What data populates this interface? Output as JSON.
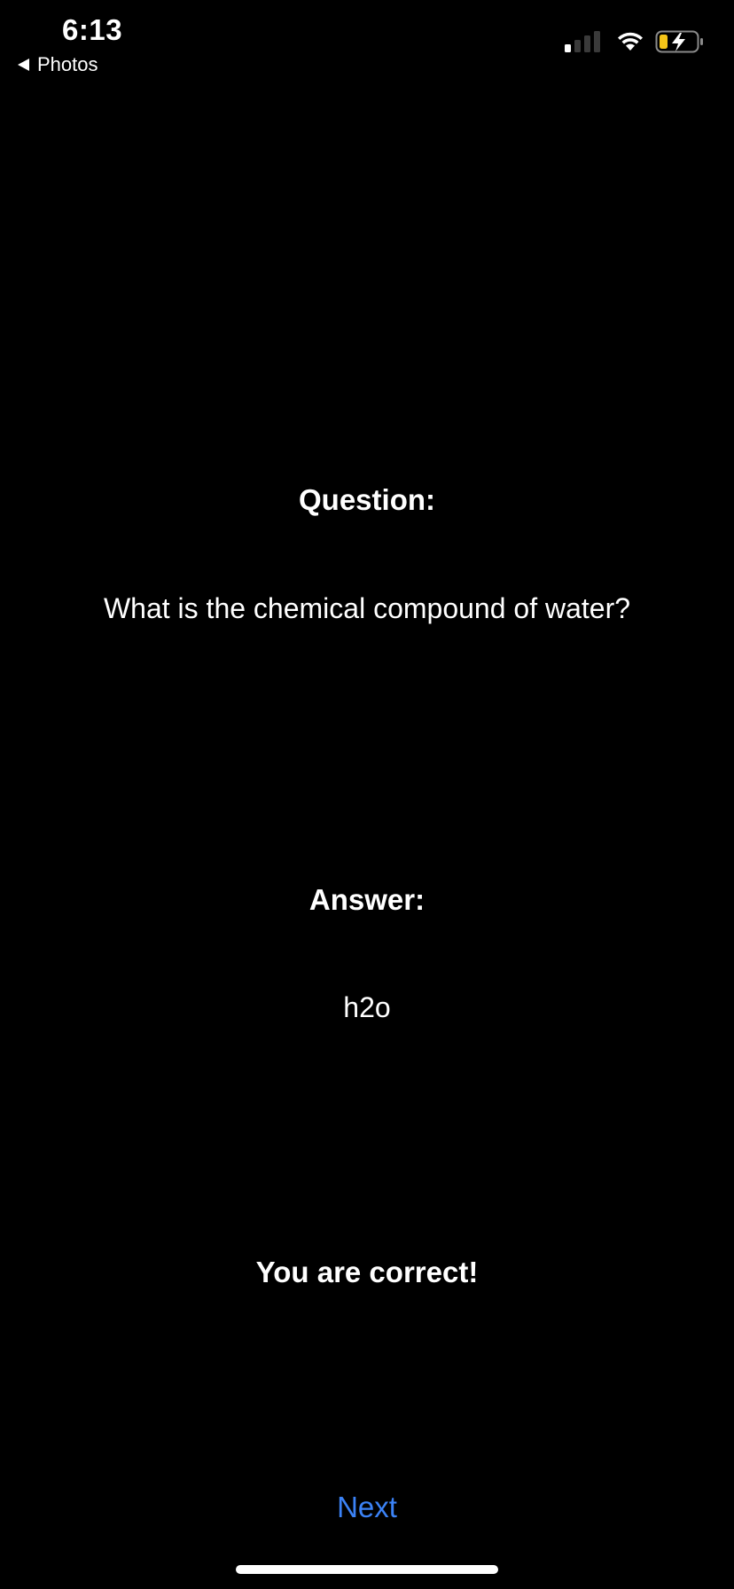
{
  "status_bar": {
    "time": "6:13",
    "back_label": "Photos",
    "battery_color": "#f5c518"
  },
  "quiz": {
    "question_label": "Question:",
    "question_text": "What is the chemical compound of water?",
    "answer_label": "Answer:",
    "answer_text": "h2o",
    "result_text": "You are correct!",
    "next_label": "Next"
  },
  "colors": {
    "background": "#000000",
    "text": "#ffffff",
    "accent": "#3b82f6"
  }
}
